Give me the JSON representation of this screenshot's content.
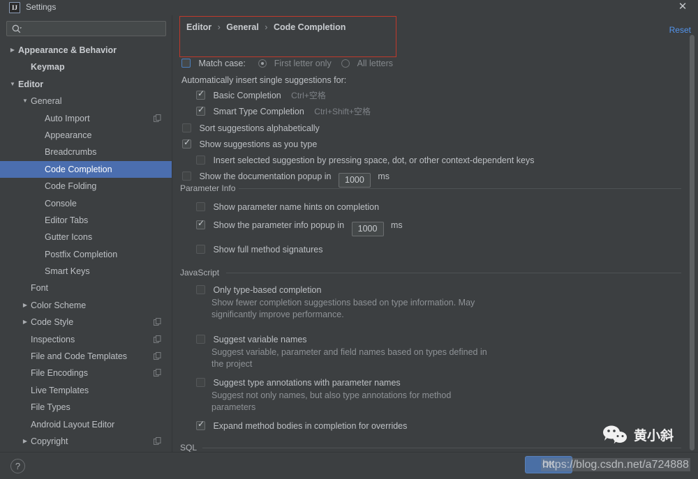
{
  "window": {
    "title": "Settings",
    "logo_text": "IJ",
    "close_icon": "✕"
  },
  "search": {
    "value": "",
    "placeholder": "",
    "icon": "search-icon"
  },
  "sidebar": {
    "items": [
      {
        "label": "Appearance & Behavior",
        "indent": 0,
        "arrow": "▶",
        "bold": true,
        "selected": false,
        "copy": false
      },
      {
        "label": "Keymap",
        "indent": 1,
        "arrow": "",
        "bold": true,
        "selected": false,
        "copy": false
      },
      {
        "label": "Editor",
        "indent": 0,
        "arrow": "▼",
        "bold": true,
        "selected": false,
        "copy": false
      },
      {
        "label": "General",
        "indent": 1,
        "arrow": "▼",
        "bold": false,
        "selected": false,
        "copy": false
      },
      {
        "label": "Auto Import",
        "indent": 2,
        "arrow": "",
        "bold": false,
        "selected": false,
        "copy": true
      },
      {
        "label": "Appearance",
        "indent": 2,
        "arrow": "",
        "bold": false,
        "selected": false,
        "copy": false
      },
      {
        "label": "Breadcrumbs",
        "indent": 2,
        "arrow": "",
        "bold": false,
        "selected": false,
        "copy": false
      },
      {
        "label": "Code Completion",
        "indent": 2,
        "arrow": "",
        "bold": false,
        "selected": true,
        "copy": false
      },
      {
        "label": "Code Folding",
        "indent": 2,
        "arrow": "",
        "bold": false,
        "selected": false,
        "copy": false
      },
      {
        "label": "Console",
        "indent": 2,
        "arrow": "",
        "bold": false,
        "selected": false,
        "copy": false
      },
      {
        "label": "Editor Tabs",
        "indent": 2,
        "arrow": "",
        "bold": false,
        "selected": false,
        "copy": false
      },
      {
        "label": "Gutter Icons",
        "indent": 2,
        "arrow": "",
        "bold": false,
        "selected": false,
        "copy": false
      },
      {
        "label": "Postfix Completion",
        "indent": 2,
        "arrow": "",
        "bold": false,
        "selected": false,
        "copy": false
      },
      {
        "label": "Smart Keys",
        "indent": 2,
        "arrow": "",
        "bold": false,
        "selected": false,
        "copy": false
      },
      {
        "label": "Font",
        "indent": 1,
        "arrow": "",
        "bold": false,
        "selected": false,
        "copy": false
      },
      {
        "label": "Color Scheme",
        "indent": 1,
        "arrow": "▶",
        "bold": false,
        "selected": false,
        "copy": false
      },
      {
        "label": "Code Style",
        "indent": 1,
        "arrow": "▶",
        "bold": false,
        "selected": false,
        "copy": true
      },
      {
        "label": "Inspections",
        "indent": 1,
        "arrow": "",
        "bold": false,
        "selected": false,
        "copy": true
      },
      {
        "label": "File and Code Templates",
        "indent": 1,
        "arrow": "",
        "bold": false,
        "selected": false,
        "copy": true
      },
      {
        "label": "File Encodings",
        "indent": 1,
        "arrow": "",
        "bold": false,
        "selected": false,
        "copy": true
      },
      {
        "label": "Live Templates",
        "indent": 1,
        "arrow": "",
        "bold": false,
        "selected": false,
        "copy": false
      },
      {
        "label": "File Types",
        "indent": 1,
        "arrow": "",
        "bold": false,
        "selected": false,
        "copy": false
      },
      {
        "label": "Android Layout Editor",
        "indent": 1,
        "arrow": "",
        "bold": false,
        "selected": false,
        "copy": false
      },
      {
        "label": "Copyright",
        "indent": 1,
        "arrow": "▶",
        "bold": false,
        "selected": false,
        "copy": true
      }
    ],
    "selected_bg": "#4b6eaf"
  },
  "main": {
    "breadcrumb": {
      "parts": [
        "Editor",
        "General",
        "Code Completion"
      ],
      "separator": "›"
    },
    "reset_label": "Reset",
    "match_case": {
      "label": "Match case:",
      "checked": false,
      "options": [
        {
          "label": "First letter only",
          "selected": true
        },
        {
          "label": "All letters",
          "selected": false
        }
      ]
    },
    "auto_insert_header": "Automatically insert single suggestions for:",
    "auto_insert_options": [
      {
        "label": "Basic Completion",
        "shortcut": "Ctrl+空格",
        "checked": true
      },
      {
        "label": "Smart Type Completion",
        "shortcut": "Ctrl+Shift+空格",
        "checked": true
      }
    ],
    "top_options": [
      {
        "label": "Sort suggestions alphabetically",
        "checked": false
      },
      {
        "label": "Show suggestions as you type",
        "checked": true
      },
      {
        "label": "Insert selected suggestion by pressing space, dot, or other context-dependent keys",
        "checked": false
      }
    ],
    "doc_popup": {
      "label_before": "Show the documentation popup in",
      "value": "1000",
      "unit": "ms",
      "checked": false
    },
    "sections": [
      {
        "id": "parameter-info",
        "title": "Parameter Info"
      },
      {
        "id": "javascript",
        "title": "JavaScript"
      },
      {
        "id": "sql",
        "title": "SQL"
      }
    ],
    "parameter_info": {
      "options": [
        {
          "label": "Show parameter name hints on completion",
          "checked": false
        },
        {
          "label": "Show full method signatures",
          "checked": false
        }
      ],
      "popup": {
        "label_before": "Show the parameter info popup in",
        "value": "1000",
        "unit": "ms",
        "checked": true
      }
    },
    "javascript": {
      "options": [
        {
          "label": "Only type-based completion",
          "checked": false,
          "description": "Show fewer completion suggestions based on type information. May\nsignificantly improve performance."
        },
        {
          "label": "Suggest variable names",
          "checked": false,
          "description": "Suggest variable, parameter and field names based on types defined in\nthe project"
        },
        {
          "label": "Suggest type annotations with parameter names",
          "checked": false,
          "description": "Suggest not only names, but also type annotations for method\nparameters"
        },
        {
          "label": "Expand method bodies in completion for overrides",
          "checked": true,
          "description": ""
        }
      ]
    }
  },
  "footer": {
    "help_label": "?",
    "ok_label": "OK"
  },
  "watermarks": {
    "wechat_name": "黄小斜",
    "url": "https://blog.csdn.net/a724888"
  },
  "colors": {
    "accent": "#4b6eaf",
    "link": "#5394ec",
    "highlight_box": "#c0392b",
    "background": "#3c3f41"
  }
}
